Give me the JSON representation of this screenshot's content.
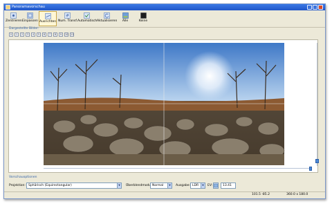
{
  "window": {
    "title": "Panoramavorschau"
  },
  "toolbar": {
    "buttons": [
      {
        "label": "Zentrieren"
      },
      {
        "label": "Einpassen"
      },
      {
        "label": "Ausrichten"
      },
      {
        "label": "Num. Transf."
      },
      {
        "label": "Automatisch"
      },
      {
        "label": "Aktualisieren"
      },
      {
        "label": "Alle"
      },
      {
        "label": "Keine"
      }
    ]
  },
  "images_panel": {
    "label": "Dargestellte Bilder:",
    "buttons": [
      "0",
      "1",
      "2",
      "3",
      "4",
      "5",
      "6",
      "7",
      "8",
      "9",
      "10",
      "11"
    ]
  },
  "preview_settings": {
    "label": "Vorschauoptionen"
  },
  "bottombar": {
    "projection_label": "Projektion:",
    "projection_value": "Sphärisch (Equirectangular)",
    "blend_label": "Überblendmodus:",
    "blend_value": "Normal",
    "output_label": "Ausgabe:",
    "output_value": "LDR",
    "ev_label": "EV:",
    "ev_value": "13.41"
  },
  "status": {
    "fov": "101.5 -85.2",
    "size": "360.0 x 180.0"
  },
  "colors": {
    "titlebar": "#245edb",
    "window_bg": "#ece9d8",
    "accent": "#2f5fa8"
  }
}
